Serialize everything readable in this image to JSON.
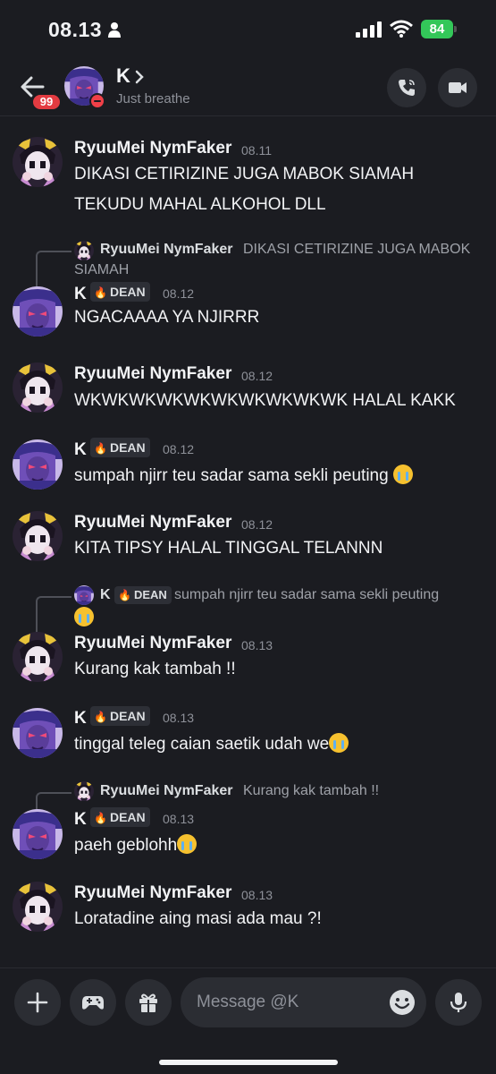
{
  "status": {
    "time": "08.13",
    "battery": "84"
  },
  "header": {
    "badge": "99",
    "name": "K",
    "status": "Just breathe"
  },
  "messages": [
    {
      "user": "RyuuMei NymFaker",
      "time": "08.11",
      "lines": [
        "DIKASI CETIRIZINE JUGA MABOK SIAMAH",
        "TEKUDU MAHAL ALKOHOL DLL"
      ]
    },
    {
      "reply_user": "RyuuMei NymFaker",
      "reply_text": "DIKASI CETIRIZINE JUGA MABOK",
      "reply_text_cont": "SIAMAH",
      "user": "K",
      "tag": "DEAN",
      "time": "08.12",
      "lines": [
        "NGACAAAA YA NJIRRR"
      ]
    },
    {
      "user": "RyuuMei NymFaker",
      "time": "08.12",
      "lines": [
        "WKWKWKWKWKWKWKWKWKWK HALAL KAKK"
      ]
    },
    {
      "user": "K",
      "tag": "DEAN",
      "time": "08.12",
      "lines": [
        "sumpah njirr teu sadar sama sekli peuting"
      ]
    },
    {
      "user": "RyuuMei NymFaker",
      "time": "08.12",
      "lines": [
        "KITA TIPSY HALAL TINGGAL TELANNN"
      ]
    },
    {
      "reply_user": "K",
      "reply_tag": "DEAN",
      "reply_text": "sumpah njirr teu sadar sama sekli peuting",
      "user": "RyuuMei NymFaker",
      "time": "08.13",
      "lines": [
        "Kurang kak tambah !!"
      ]
    },
    {
      "user": "K",
      "tag": "DEAN",
      "time": "08.13",
      "lines": [
        "tinggal teleg caian saetik udah we"
      ]
    },
    {
      "reply_user": "RyuuMei NymFaker",
      "reply_text": "Kurang kak tambah !!",
      "user": "K",
      "tag": "DEAN",
      "time": "08.13",
      "lines": [
        "paeh geblohh"
      ]
    },
    {
      "user": "RyuuMei NymFaker",
      "time": "08.13",
      "lines": [
        "Loratadine aing masi ada mau ?!"
      ]
    }
  ],
  "composer": {
    "placeholder": "Message @K"
  },
  "icons": {
    "back": "arrow-left-icon",
    "call": "phone-icon",
    "video": "video-icon",
    "add": "plus-icon",
    "game": "gamepad-icon",
    "gift": "gift-icon",
    "emoji": "smiley-icon",
    "mic": "microphone-icon",
    "crying": "loudly-crying-emoji"
  },
  "colors": {
    "background": "#1b1c21",
    "dnd": "#f04048",
    "badge": "#e33b41",
    "battery": "#33c759"
  }
}
